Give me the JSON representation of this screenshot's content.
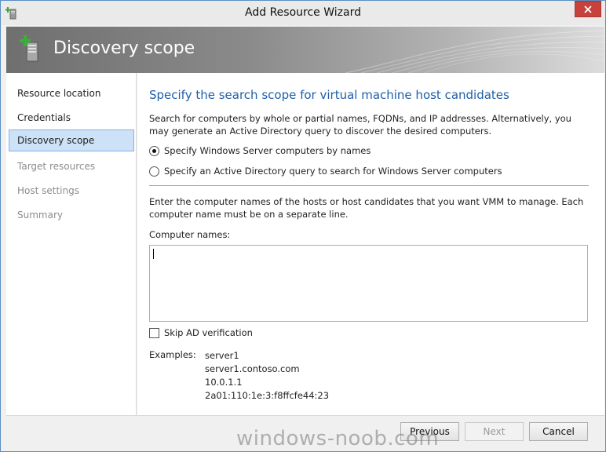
{
  "window": {
    "title": "Add Resource Wizard"
  },
  "banner": {
    "title": "Discovery scope"
  },
  "nav": {
    "items": [
      {
        "label": "Resource location",
        "state": "normal"
      },
      {
        "label": "Credentials",
        "state": "normal"
      },
      {
        "label": "Discovery scope",
        "state": "active"
      },
      {
        "label": "Target resources",
        "state": "disabled"
      },
      {
        "label": "Host settings",
        "state": "disabled"
      },
      {
        "label": "Summary",
        "state": "disabled"
      }
    ]
  },
  "content": {
    "heading": "Specify the search scope for virtual machine host candidates",
    "description": "Search for computers by whole or partial names, FQDNs, and IP addresses. Alternatively, you may generate an Active Directory query to discover the desired computers.",
    "radio_names": "Specify Windows Server computers by names",
    "radio_ad": "Specify an Active Directory query to search for Windows Server computers",
    "enter_text": "Enter the computer names of the hosts or host candidates that you want VMM to manage. Each computer name must be on a separate line.",
    "computer_names_label": "Computer names:",
    "computer_names_value": "",
    "skip_ad_label": "Skip AD verification",
    "skip_ad_checked": false,
    "examples_label": "Examples:",
    "examples": [
      "server1",
      "server1.contoso.com",
      "10.0.1.1",
      "2a01:110:1e:3:f8ffcfe44:23"
    ]
  },
  "footer": {
    "previous": "Previous",
    "next": "Next",
    "cancel": "Cancel"
  },
  "watermark": "windows-noob.com",
  "colors": {
    "heading": "#1e5fa8",
    "nav_active_bg": "#cde1f7",
    "close_button": "#c7423a"
  }
}
